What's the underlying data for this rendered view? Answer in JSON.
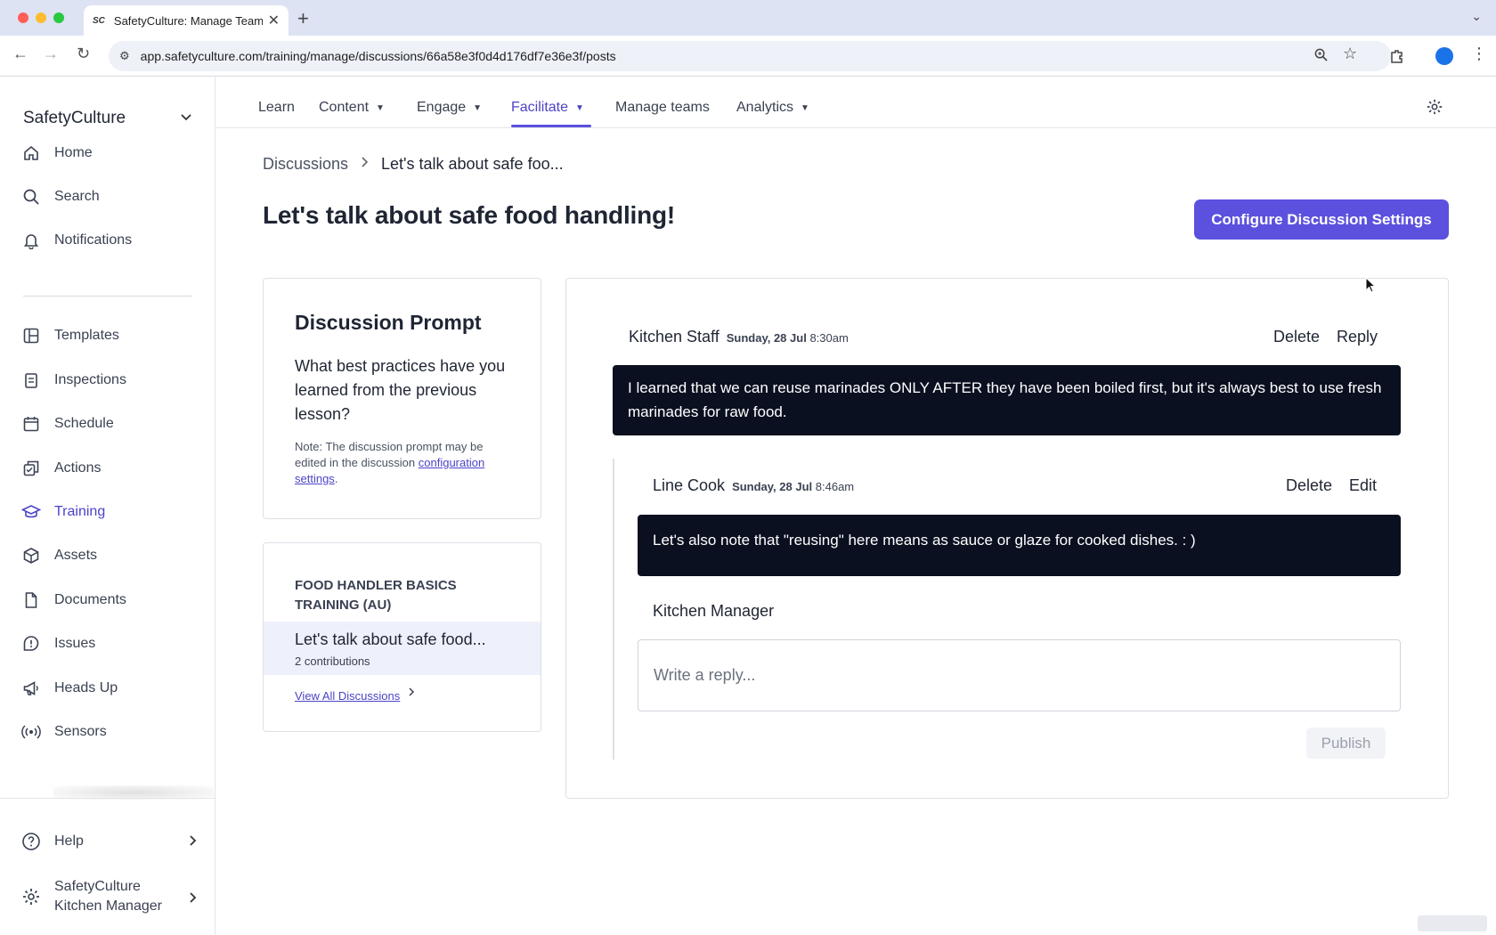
{
  "browser": {
    "tab_title": "SafetyCulture: Manage Teams",
    "tab_favicon": "SC",
    "url": "app.safetyculture.com/training/manage/discussions/66a58e3f0d4d176df7e36e3f/posts"
  },
  "sidebar": {
    "org_name": "SafetyCulture",
    "items": [
      {
        "label": "Home",
        "icon": "home-icon"
      },
      {
        "label": "Search",
        "icon": "search-icon"
      },
      {
        "label": "Notifications",
        "icon": "bell-icon"
      },
      {
        "label": "Templates",
        "icon": "templates-icon"
      },
      {
        "label": "Inspections",
        "icon": "clipboard-icon"
      },
      {
        "label": "Schedule",
        "icon": "calendar-icon"
      },
      {
        "label": "Actions",
        "icon": "actions-icon"
      },
      {
        "label": "Training",
        "icon": "graduation-cap-icon",
        "active": true
      },
      {
        "label": "Assets",
        "icon": "cube-icon"
      },
      {
        "label": "Documents",
        "icon": "document-icon"
      },
      {
        "label": "Issues",
        "icon": "alert-icon"
      },
      {
        "label": "Heads Up",
        "icon": "megaphone-icon"
      },
      {
        "label": "Sensors",
        "icon": "sensor-icon"
      }
    ],
    "help_label": "Help",
    "account_line1": "SafetyCulture",
    "account_line2": "Kitchen Manager"
  },
  "topnav": {
    "items": [
      {
        "label": "Learn",
        "dropdown": false
      },
      {
        "label": "Content",
        "dropdown": true
      },
      {
        "label": "Engage",
        "dropdown": true
      },
      {
        "label": "Facilitate",
        "dropdown": true,
        "active": true
      },
      {
        "label": "Manage teams",
        "dropdown": false
      },
      {
        "label": "Analytics",
        "dropdown": true
      }
    ]
  },
  "breadcrumb": {
    "parent": "Discussions",
    "current": "Let's talk about safe foo..."
  },
  "page": {
    "title": "Let's talk about safe food handling!",
    "configure_button": "Configure Discussion Settings"
  },
  "prompt": {
    "heading": "Discussion Prompt",
    "question": "What best practices have you learned from the previous lesson?",
    "note_prefix": "Note: The discussion prompt may be edited in the discussion ",
    "note_link": "configuration settings",
    "note_suffix": "."
  },
  "course": {
    "name": "FOOD HANDLER BASICS TRAINING (AU)",
    "selected_title": "Let's talk about safe food...",
    "selected_count": "2 contributions",
    "view_all": "View All Discussions"
  },
  "posts": {
    "main": {
      "author": "Kitchen Staff",
      "date_day": "Sunday, 28 Jul",
      "date_time": "8:30am",
      "action1": "Delete",
      "action2": "Reply",
      "body": "I learned that we can reuse marinades ONLY AFTER they have been boiled first, but it's always best to use fresh marinades for raw food."
    },
    "reply": {
      "author": "Line Cook",
      "date_day": "Sunday, 28 Jul",
      "date_time": "8:46am",
      "action1": "Delete",
      "action2": "Edit",
      "body": "Let's also note that \"reusing\" here means as sauce or glaze for cooked dishes. : )"
    },
    "composer": {
      "author": "Kitchen Manager",
      "placeholder": "Write a reply...",
      "publish_label": "Publish"
    }
  },
  "colors": {
    "accent": "#5b51de",
    "bubble": "#0b1020"
  }
}
